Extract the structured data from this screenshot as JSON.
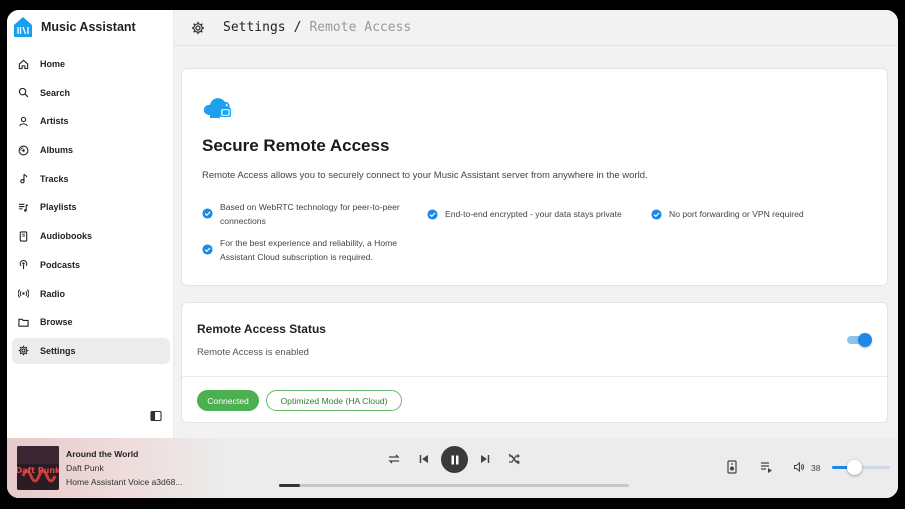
{
  "app": {
    "name": "Music Assistant"
  },
  "sidebar": {
    "items": [
      {
        "label": "Home",
        "icon": "home-icon"
      },
      {
        "label": "Search",
        "icon": "search-icon"
      },
      {
        "label": "Artists",
        "icon": "person-icon"
      },
      {
        "label": "Albums",
        "icon": "disc-icon"
      },
      {
        "label": "Tracks",
        "icon": "music-note-icon"
      },
      {
        "label": "Playlists",
        "icon": "playlist-icon"
      },
      {
        "label": "Audiobooks",
        "icon": "book-icon"
      },
      {
        "label": "Podcasts",
        "icon": "podcast-icon"
      },
      {
        "label": "Radio",
        "icon": "radio-icon"
      },
      {
        "label": "Browse",
        "icon": "folder-icon"
      },
      {
        "label": "Settings",
        "icon": "gear-icon",
        "active": true
      }
    ]
  },
  "header": {
    "breadcrumb_root": "Settings",
    "separator": "/",
    "breadcrumb_current": "Remote Access"
  },
  "intro_card": {
    "title": "Secure Remote Access",
    "description": "Remote Access allows you to securely connect to your Music Assistant server from anywhere in the world.",
    "features": [
      {
        "line1": "Based on WebRTC technology for peer-to-peer",
        "line2": "connections"
      },
      {
        "line1": "End-to-end encrypted - your data stays private"
      },
      {
        "line1": "No port forwarding or VPN required"
      },
      {
        "line1": "For the best experience and reliability, a Home",
        "line2": "Assistant Cloud subscription is required."
      }
    ]
  },
  "status_card": {
    "title": "Remote Access Status",
    "status_text": "Remote Access is enabled",
    "toggle_on": true,
    "chip_connected": "Connected",
    "chip_mode": "Optimized Mode (HA Cloud)"
  },
  "player": {
    "track_title": "Around the World",
    "artist": "Daft Punk",
    "player_name": "Home Assistant Voice a3d68...",
    "album_art_text": "Daft Punk",
    "progress_fraction": 0.06,
    "volume": "38",
    "volume_fraction": 0.38
  },
  "colors": {
    "accent": "#1e88e5",
    "success": "#4caf50",
    "check": "#1e88e5"
  }
}
